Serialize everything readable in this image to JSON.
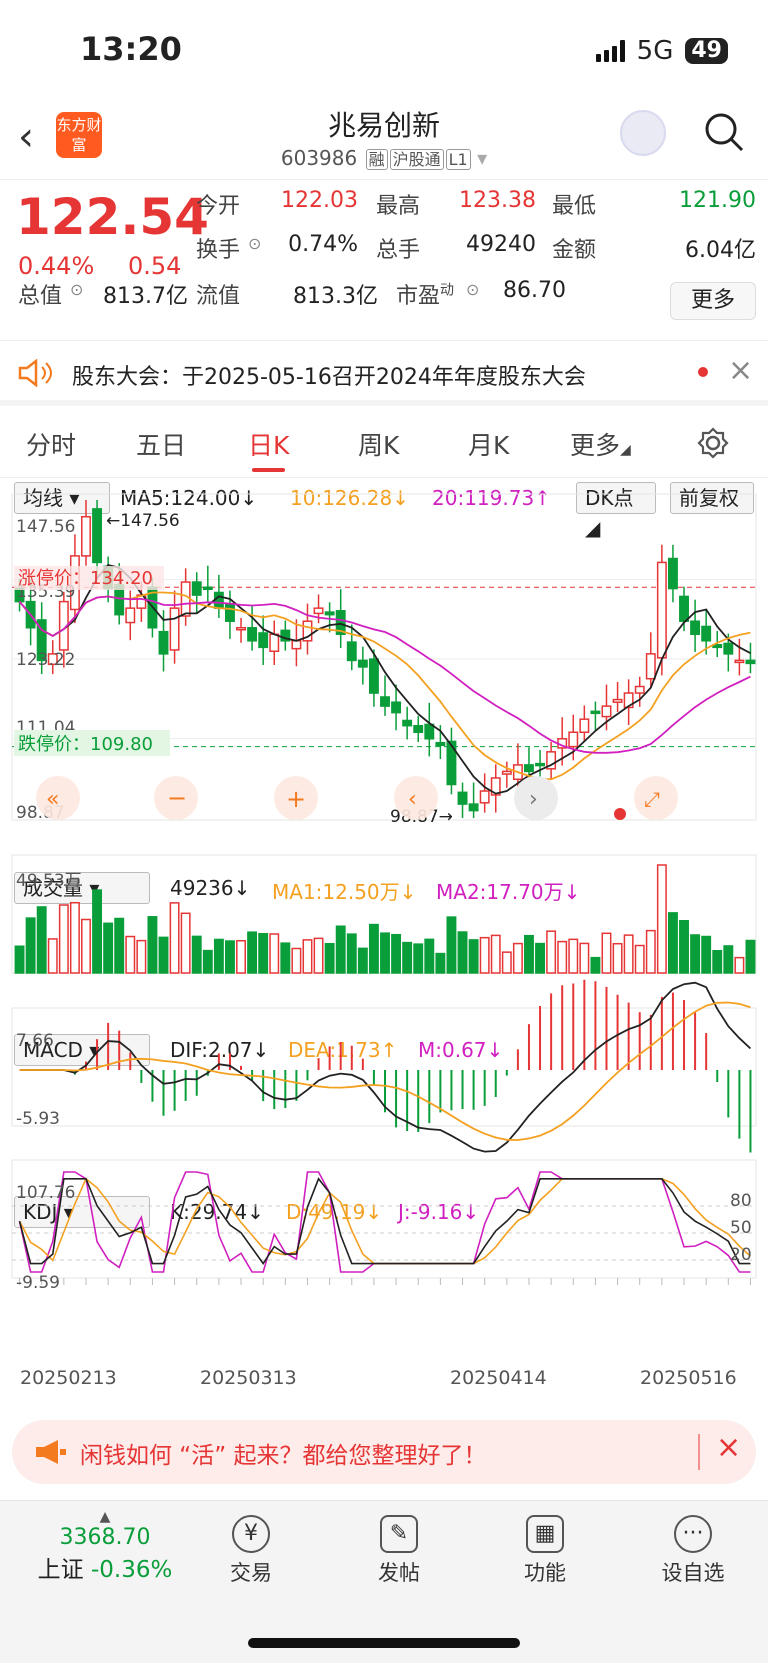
{
  "status": {
    "time": "13:20",
    "network": "5G",
    "battery": "49"
  },
  "nav": {
    "title": "兆易创新",
    "code": "603986",
    "tags": [
      "融",
      "沪股通",
      "L1"
    ],
    "logo": "东方财富"
  },
  "quote": {
    "price": "122.54",
    "pct": "0.44%",
    "change": "0.54",
    "open_l": "今开",
    "open_v": "122.03",
    "high_l": "最高",
    "high_v": "123.38",
    "low_l": "最低",
    "low_v": "121.90",
    "turn_l": "换手",
    "turn_v": "0.74%",
    "vol_l": "总手",
    "vol_v": "49240",
    "amt_l": "金额",
    "amt_v": "6.04亿",
    "mcap_l": "总值",
    "mcap_v": "813.7亿",
    "float_l": "流值",
    "float_v": "813.3亿",
    "pe_l": "市盈",
    "pe_sup": "动",
    "pe_v": "86.70",
    "more": "更多"
  },
  "notice": {
    "text": "股东大会：于2025-05-16召开2024年年度股东大会"
  },
  "tabs": [
    "分时",
    "五日",
    "日K",
    "周K",
    "月K",
    "更多"
  ],
  "ma": {
    "sel": "均线",
    "ma5": "MA5:124.00↓",
    "ma10": "10:126.28↓",
    "ma20": "20:119.73↑",
    "dk": "DK点",
    "adj": "前复权"
  },
  "price_axis": {
    "a": "147.56",
    "b": "135.39",
    "c": "123.22",
    "d": "111.04",
    "e": "98.87",
    "high_mark": "←147.56",
    "low_mark": "98.87→",
    "limit_up": "涨停价：134.20",
    "limit_down": "跌停价：109.80"
  },
  "vol": {
    "sel": "成交量",
    "v": "49236↓",
    "ma1": "MA1:12.50万↓",
    "ma2": "MA2:17.70万↓",
    "axis": "49.53万"
  },
  "macd": {
    "sel": "MACD",
    "dif": "DIF:2.07↓",
    "dea": "DEA:1.73↑",
    "m": "M:0.67↓",
    "top": "7.66",
    "bot": "-5.93"
  },
  "kdj": {
    "sel": "KDJ",
    "k": "K:29.74↓",
    "d": "D:49.19↓",
    "j": "J:-9.16↓",
    "top": "107.76",
    "bot": "-9.59",
    "l80": "80",
    "l50": "50",
    "l20": "20"
  },
  "dates": [
    "20250213",
    "20250313",
    "20250414",
    "20250516"
  ],
  "banner": {
    "text": "闲钱如何 “活” 起来？都给您整理好了！"
  },
  "bottom": {
    "index_val": "3368.70",
    "index_name": "上证",
    "index_pct": "-0.36%",
    "items": [
      "交易",
      "发帖",
      "功能",
      "设自选"
    ]
  },
  "chart_data": {
    "type": "candlestick",
    "title": "兆易创新 日K",
    "closes": [
      132,
      128,
      123,
      124,
      132,
      139,
      145,
      138,
      134,
      130,
      131,
      133,
      128,
      124,
      131,
      135,
      133,
      134,
      131,
      129,
      128,
      126,
      125,
      127,
      126,
      126,
      129,
      131,
      130,
      127,
      123,
      122,
      118,
      116,
      115,
      113,
      112,
      111,
      110,
      104,
      101,
      100,
      103,
      105,
      106,
      107,
      106,
      107,
      109,
      111,
      112,
      114,
      115,
      116,
      117,
      118,
      119,
      124,
      138,
      134,
      129,
      127,
      126,
      125,
      124,
      123,
      122.54
    ],
    "price_range": [
      98.87,
      147.56
    ],
    "limit_up": 134.2,
    "limit_down": 109.8,
    "x_ticks": [
      "20250213",
      "20250313",
      "20250414",
      "20250516"
    ]
  }
}
